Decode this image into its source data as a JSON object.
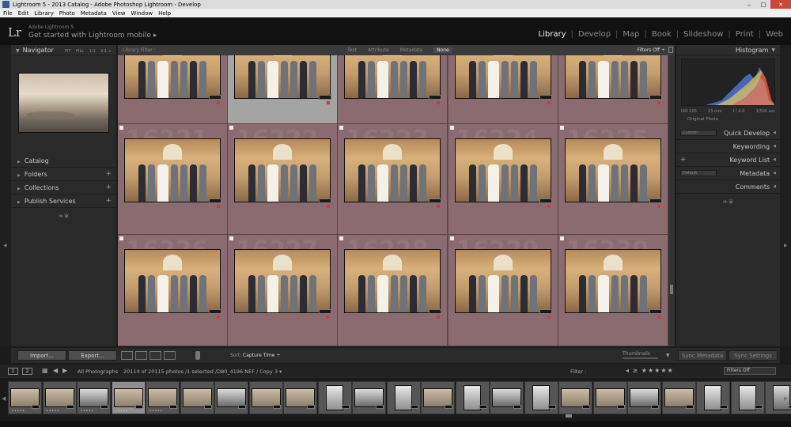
{
  "window": {
    "title": "Lightroom 5 - 2013 Catalog - Adobe Photoshop Lightroom - Develop",
    "buttons": [
      "–",
      "□",
      "✕"
    ]
  },
  "menu": [
    "File",
    "Edit",
    "Library",
    "Photo",
    "Metadata",
    "View",
    "Window",
    "Help"
  ],
  "identity": {
    "logo": "Lr",
    "small": "Adobe Lightroom 5",
    "main": "Get started with Lightroom mobile ▸"
  },
  "modules": [
    {
      "label": "Library",
      "active": true
    },
    {
      "label": "Develop",
      "active": false
    },
    {
      "label": "Map",
      "active": false
    },
    {
      "label": "Book",
      "active": false
    },
    {
      "label": "Slideshow",
      "active": false
    },
    {
      "label": "Print",
      "active": false
    },
    {
      "label": "Web",
      "active": false
    }
  ],
  "navigator": {
    "title": "Navigator",
    "zooms": [
      "FIT",
      "FILL",
      "1:1",
      "2:1 ÷"
    ]
  },
  "left_panels": [
    {
      "label": "Catalog",
      "plus": ""
    },
    {
      "label": "Folders",
      "plus": "+"
    },
    {
      "label": "Collections",
      "plus": "+"
    },
    {
      "label": "Publish Services",
      "plus": "+"
    }
  ],
  "filter_bar": {
    "label": "Library Filter :",
    "options": [
      "Text",
      "Attribute",
      "Metadata",
      "None"
    ],
    "active": "None",
    "filters_off": "Filters Off ÷"
  },
  "grid": {
    "cell_numbers": [
      "",
      "",
      "",
      "",
      "",
      "16221",
      "16222",
      "16223",
      "16224",
      "16225",
      "16226",
      "16227",
      "16228",
      "16229",
      "16230"
    ]
  },
  "histogram": {
    "title": "Histogram",
    "info": [
      "ISO 100",
      "23 mm",
      "f / 4.0",
      "1/500 sec"
    ],
    "original_label": "Original Photo"
  },
  "right_panels": [
    {
      "label": "Quick Develop",
      "select": "Custom"
    },
    {
      "label": "Keywording",
      "select": ""
    },
    {
      "label": "Keyword List",
      "select": "+"
    },
    {
      "label": "Metadata",
      "select": "Default"
    },
    {
      "label": "Comments",
      "select": ""
    }
  ],
  "toolbar": {
    "import": "Import...",
    "export": "Export...",
    "sort_label": "Sort:",
    "sort_value": "Capture Time ÷",
    "thumbnails": "Thumbnails",
    "sync_metadata": "Sync Metadata",
    "sync_settings": "Sync Settings"
  },
  "filmstrip_bar": {
    "pages": [
      "1",
      "2"
    ],
    "source": "All Photographs",
    "count": "20114 of 20115 photos /1 selected /D80_4196.NEF / Copy 3 ▾",
    "filter": "Filter :",
    "filters_off": "Filters Off"
  },
  "colors": {
    "grid_bg": "#6b4f53",
    "panel": "#2a2a2a",
    "close": "#c9483b"
  }
}
